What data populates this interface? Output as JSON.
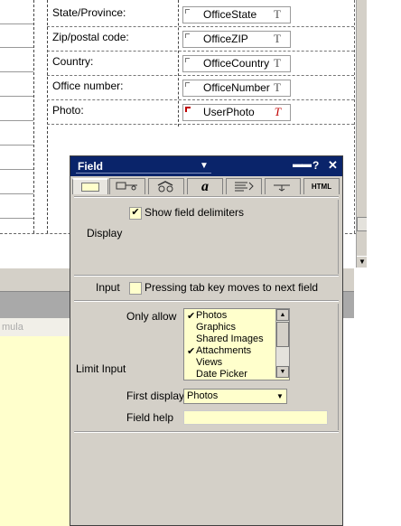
{
  "form": {
    "rows": [
      {
        "label": "State/Province:",
        "field": "OfficeState",
        "type_glyph": "T"
      },
      {
        "label": "Zip/postal code:",
        "field": "OfficeZIP",
        "type_glyph": "T"
      },
      {
        "label": "Country:",
        "field": "OfficeCountry",
        "type_glyph": "T"
      },
      {
        "label": "Office number:",
        "field": "OfficeNumber",
        "type_glyph": "T"
      },
      {
        "label": "Photo:",
        "field": "UserPhoto",
        "type_glyph": "T"
      }
    ]
  },
  "formula_hint": "mula",
  "dialog": {
    "title": "Field",
    "tabs": [
      {
        "icon": "field-info-tab-icon"
      },
      {
        "icon": "control-options-tab-icon"
      },
      {
        "icon": "advanced-tab-icon"
      },
      {
        "icon": "font-tab-icon",
        "text": "a"
      },
      {
        "icon": "paragraph-alignment-tab-icon"
      },
      {
        "icon": "hide-when-tab-icon"
      },
      {
        "icon": "html-tab-icon",
        "text": "HTML"
      }
    ],
    "display": {
      "label": "Display",
      "show_delimiters_label": "Show field delimiters",
      "show_delimiters_checked": true
    },
    "input": {
      "label": "Input",
      "tab_moves_label": "Pressing tab key moves to next field",
      "tab_moves_checked": false
    },
    "limit_input": {
      "label": "Limit Input",
      "only_allow_label": "Only allow",
      "options": [
        {
          "text": "Photos",
          "checked": true
        },
        {
          "text": "Graphics",
          "checked": false
        },
        {
          "text": "Shared Images",
          "checked": false
        },
        {
          "text": "Attachments",
          "checked": true
        },
        {
          "text": "Views",
          "checked": false
        },
        {
          "text": "Date Picker",
          "checked": false
        }
      ],
      "first_display_label": "First display",
      "first_display_value": "Photos",
      "field_help_label": "Field help",
      "field_help_value": ""
    },
    "check_mark": "✔",
    "colors": {
      "titlebar": "#0a246a",
      "control_bg": "#ffffcc",
      "panel": "#d4d0c8"
    }
  }
}
